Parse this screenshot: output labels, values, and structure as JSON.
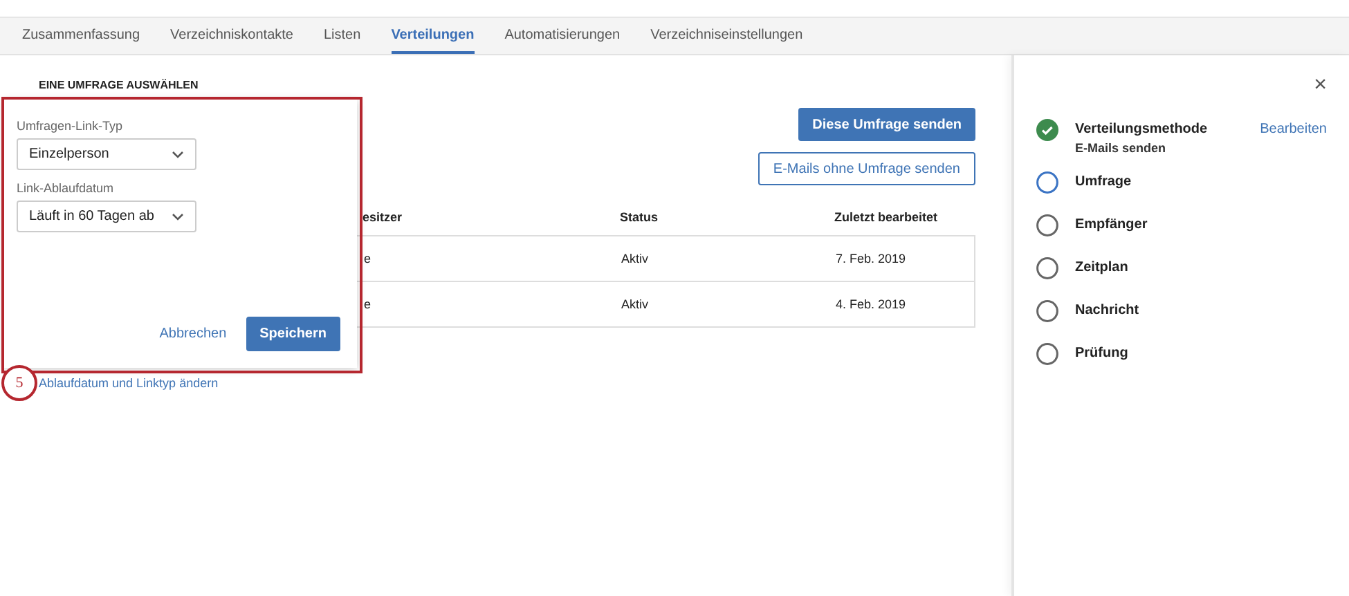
{
  "tabs": [
    {
      "label": "Zusammenfassung",
      "selected": false
    },
    {
      "label": "Verzeichniskontakte",
      "selected": false
    },
    {
      "label": "Listen",
      "selected": false
    },
    {
      "label": "Verteilungen",
      "selected": true
    },
    {
      "label": "Automatisierungen",
      "selected": false
    },
    {
      "label": "Verzeichniseinstellungen",
      "selected": false
    }
  ],
  "section_title": "EINE UMFRAGE AUSWÄHLEN",
  "buttons": {
    "primary": "Diese Umfrage senden",
    "secondary": "E-Mails ohne Umfrage senden"
  },
  "table": {
    "columns": [
      "esitzer",
      "Status",
      "Zuletzt bearbeitet"
    ],
    "rows": [
      [
        "e",
        "Aktiv",
        "7. Feb. 2019"
      ],
      [
        "e",
        "Aktiv",
        "4. Feb. 2019"
      ]
    ]
  },
  "popup": {
    "fields": [
      {
        "label": "Umfragen-Link-Typ",
        "value": "Einzelperson"
      },
      {
        "label": "Link-Ablaufdatum",
        "value": "Läuft in 60 Tagen ab"
      }
    ],
    "cancel": "Abbrechen",
    "save": "Speichern"
  },
  "callout": {
    "number": "5",
    "text": "Ablaufdatum und Linktyp ändern"
  },
  "steps_panel": {
    "close": "×",
    "edit": "Bearbeiten",
    "steps": [
      {
        "label": "Verteilungsmethode",
        "kind": "done",
        "detail": "E-Mails senden"
      },
      {
        "label": "Umfrage",
        "kind": "current"
      },
      {
        "label": "Empfänger",
        "kind": "pending"
      },
      {
        "label": "Zeitplan",
        "kind": "pending"
      },
      {
        "label": "Nachricht",
        "kind": "pending"
      },
      {
        "label": "Prüfung",
        "kind": "pending"
      }
    ]
  }
}
